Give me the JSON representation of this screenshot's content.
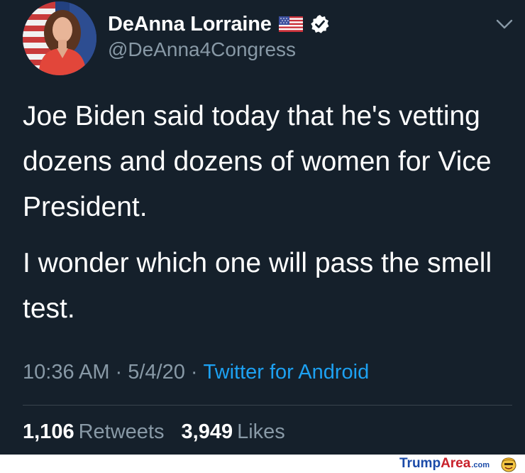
{
  "tweet": {
    "display_name": "DeAnna Lorraine",
    "handle": "@DeAnna4Congress",
    "flag_icon": "us-flag-icon",
    "verified_icon": "verified-badge-icon",
    "menu_icon": "chevron-down-icon",
    "text": [
      "Joe Biden said today that he's vetting dozens and dozens of women for Vice President.",
      "I wonder which one will pass the smell test."
    ],
    "time": "10:36 AM",
    "date": "5/4/20",
    "source": "Twitter for Android",
    "separator": "·",
    "retweets": {
      "count": "1,106",
      "label": "Retweets"
    },
    "likes": {
      "count": "3,949",
      "label": "Likes"
    }
  },
  "watermark": {
    "part1": "Trump",
    "part2": "Area",
    "part3": ".com"
  },
  "colors": {
    "background": "#15202b",
    "secondary_text": "#8899a6",
    "link": "#1da1f2",
    "divider": "#38444d"
  }
}
